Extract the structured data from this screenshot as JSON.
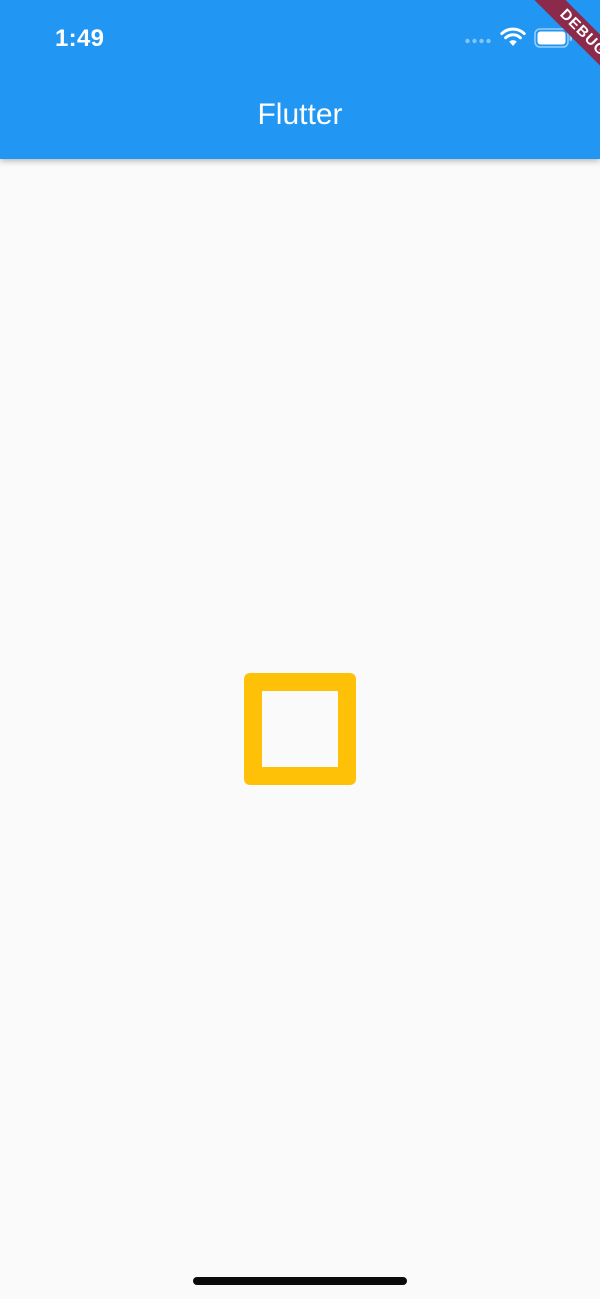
{
  "status_bar": {
    "time": "1:49",
    "icons": [
      "signal-icon",
      "wifi-icon",
      "battery-icon"
    ]
  },
  "app_bar": {
    "title": "Flutter",
    "color": "#2196f3"
  },
  "debug_banner": {
    "label": "DEBUG",
    "color": "#8b2a4a"
  },
  "content": {
    "shape": "square-outline",
    "shape_color": "#ffc107",
    "background": "#fafafa"
  },
  "home_indicator": {
    "color": "#0a0a0a"
  }
}
